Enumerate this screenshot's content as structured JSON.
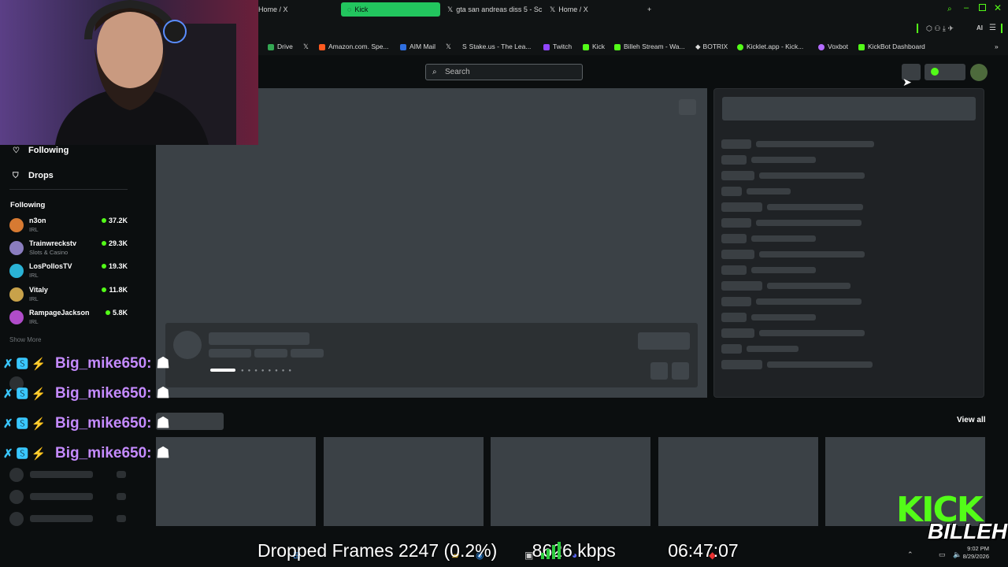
{
  "browser": {
    "tabs": [
      {
        "label": "Home / X",
        "icon": "x-icon",
        "active": false
      },
      {
        "label": "Kick",
        "icon": "kick-icon",
        "active": true
      },
      {
        "label": "gta san andreas diss 5 - Sc",
        "icon": "x-icon",
        "active": false
      },
      {
        "label": "Home / X",
        "icon": "x-icon",
        "active": false
      }
    ],
    "new_tab": "+",
    "bookmarks": [
      {
        "label": "Drive",
        "color": "#34a853"
      },
      {
        "label": "",
        "color": "#ffffff"
      },
      {
        "label": "Amazon.com. Spe...",
        "color": "#ff9900"
      },
      {
        "label": "AIM Mail",
        "color": "#2f6fe0"
      },
      {
        "label": "",
        "color": "#ffffff"
      },
      {
        "label": "Stake.us - The Lea...",
        "color": "#ffffff"
      },
      {
        "label": "Twitch",
        "color": "#9146ff"
      },
      {
        "label": "Kick",
        "color": "#53fc18"
      },
      {
        "label": "Billeh Stream - Wa...",
        "color": "#53fc18"
      },
      {
        "label": "BOTRIX",
        "color": "#ffffff"
      },
      {
        "label": "Kicklet.app - Kick...",
        "color": "#53fc18"
      },
      {
        "label": "Voxbot",
        "color": "#b36bff"
      },
      {
        "label": "KickBot Dashboard",
        "color": "#53fc18"
      }
    ]
  },
  "kick": {
    "search_placeholder": "Search",
    "nav": [
      {
        "label": "Following",
        "icon": "heart-icon"
      },
      {
        "label": "Drops",
        "icon": "gift-icon"
      }
    ],
    "following_title": "Following",
    "channels": [
      {
        "name": "n3on",
        "category": "IRL",
        "viewers": "37.2K",
        "color": "#d77a32"
      },
      {
        "name": "Trainwreckstv",
        "category": "Slots & Casino",
        "viewers": "29.3K",
        "color": "#8a7dbf"
      },
      {
        "name": "LosPollosTV",
        "category": "IRL",
        "viewers": "19.3K",
        "color": "#2ab3d6"
      },
      {
        "name": "Vitaly",
        "category": "IRL",
        "viewers": "11.8K",
        "color": "#c8a24a"
      },
      {
        "name": "RampageJackson",
        "category": "IRL",
        "viewers": "5.8K",
        "color": "#b04cc9"
      }
    ],
    "show_more": "Show More",
    "view_all": "View all"
  },
  "overlay": {
    "chat_user": "Big_mike650:",
    "chat_lines": 4,
    "obs_stats": "Dropped Frames 2247 (0.2%)",
    "bitrate": "8626 kbps",
    "uptime": "06:47:07",
    "clock_time": "9:02 PM",
    "clock_date": "8/29/2026",
    "logo_top": "KICK",
    "logo_bottom": "BILLEH"
  }
}
